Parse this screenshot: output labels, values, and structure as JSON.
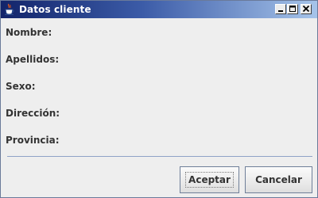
{
  "window": {
    "title": "Datos cliente",
    "controls": [
      "minimize",
      "maximize",
      "close"
    ]
  },
  "form": {
    "labels": {
      "nombre": "Nombre:",
      "apellidos": "Apellidos:",
      "sexo": "Sexo:",
      "direccion": "Dirección:",
      "provincia": "Provincia:"
    }
  },
  "buttons": {
    "accept": "Aceptar",
    "cancel": "Cancelar"
  },
  "icons": {
    "app": "java-cup-icon",
    "minimize": "minimize-icon",
    "maximize": "maximize-icon",
    "close": "close-icon"
  },
  "colors": {
    "titlebar_start": "#12246a",
    "titlebar_end": "#a6c4ea",
    "background": "#eeeeee",
    "separator": "#8ea2c6"
  }
}
